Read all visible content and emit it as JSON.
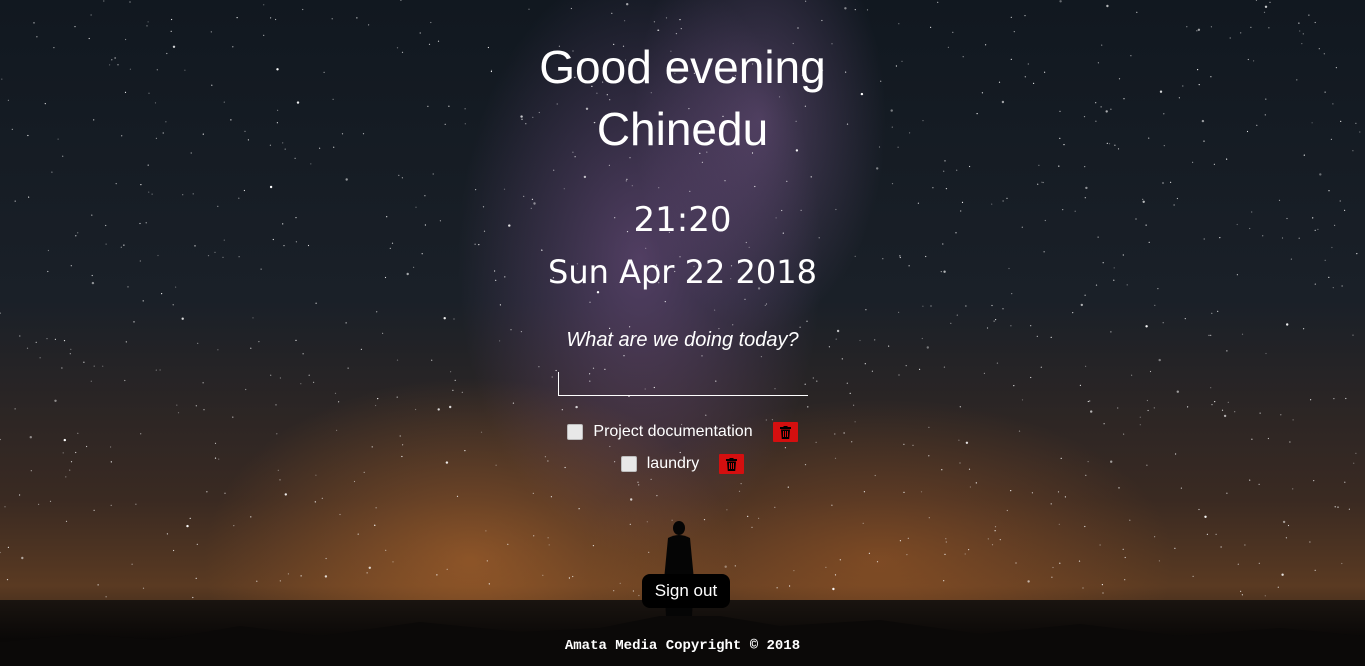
{
  "greeting": {
    "line1": "Good evening",
    "line2": "Chinedu"
  },
  "clock": {
    "time": "21:20",
    "date": "Sun Apr 22 2018"
  },
  "todo": {
    "prompt": "What are we doing today?",
    "input_value": "",
    "items": [
      {
        "text": "Project documentation",
        "checked": false,
        "delete_icon": "trash-icon"
      },
      {
        "text": "laundry",
        "checked": false,
        "delete_icon": "trash-icon"
      }
    ]
  },
  "signout": {
    "label": "Sign out"
  },
  "footer": {
    "text": "Amata Media Copyright © 2018"
  },
  "colors": {
    "delete_button": "#d40f0f",
    "signout_bg": "#000000",
    "text": "#ffffff"
  }
}
